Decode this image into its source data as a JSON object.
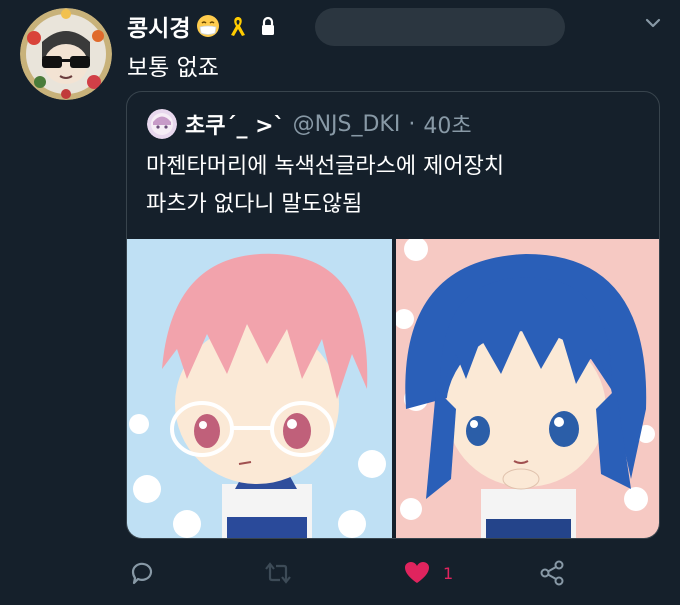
{
  "tweet": {
    "display_name": "콩시경",
    "text": "보통 없죠",
    "icons": [
      "mask-emoji-icon",
      "yellow-ribbon-icon",
      "lock-icon",
      "caret-down-icon"
    ]
  },
  "quote": {
    "display_name": "초쿠ˊ_ >ˋ",
    "handle": "@NJS_DKI",
    "separator": "·",
    "time": "40초",
    "text_line1": "마젠타머리에 녹색선글라스에 제어장치",
    "text_line2": "파츠가 없다니 말도않됨"
  },
  "actions": {
    "reply_icon": "reply-icon",
    "retweet_icon": "retweet-icon",
    "like_icon": "heart-icon",
    "like_count": "1",
    "share_icon": "share-icon",
    "like_color": "#e0245e"
  },
  "colors": {
    "background": "#15202b",
    "border": "#38444d",
    "secondary_text": "#8899a6"
  }
}
